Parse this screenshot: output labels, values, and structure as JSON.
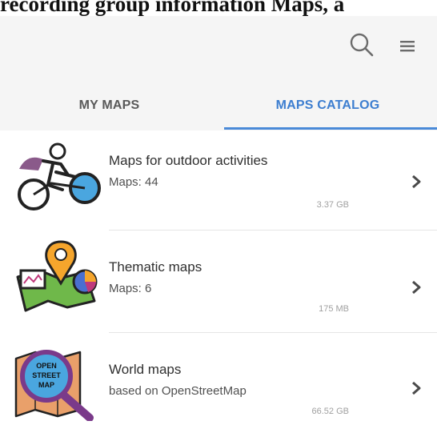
{
  "caption": "recording group information Maps, a",
  "toolbar": {
    "search_icon": "search-icon",
    "menu_icon": "hamburger-menu-icon"
  },
  "tabs": [
    {
      "label": "MY MAPS",
      "active": false
    },
    {
      "label": "MAPS CATALOG",
      "active": true
    }
  ],
  "accent_color": "#3d7ed0",
  "catalog": [
    {
      "title": "Maps for outdoor activities",
      "subtitle": "Maps: 44",
      "size": "3.37 GB",
      "icon": "cyclist-icon"
    },
    {
      "title": "Thematic maps",
      "subtitle": "Maps: 6",
      "size": "175 MB",
      "icon": "thematic-map-icon"
    },
    {
      "title": "World maps",
      "subtitle": "based on OpenStreetMap",
      "size": "66.52 GB",
      "icon": "openstreetmap-magnifier-icon",
      "icon_text": "OPEN STREET MAP"
    }
  ]
}
